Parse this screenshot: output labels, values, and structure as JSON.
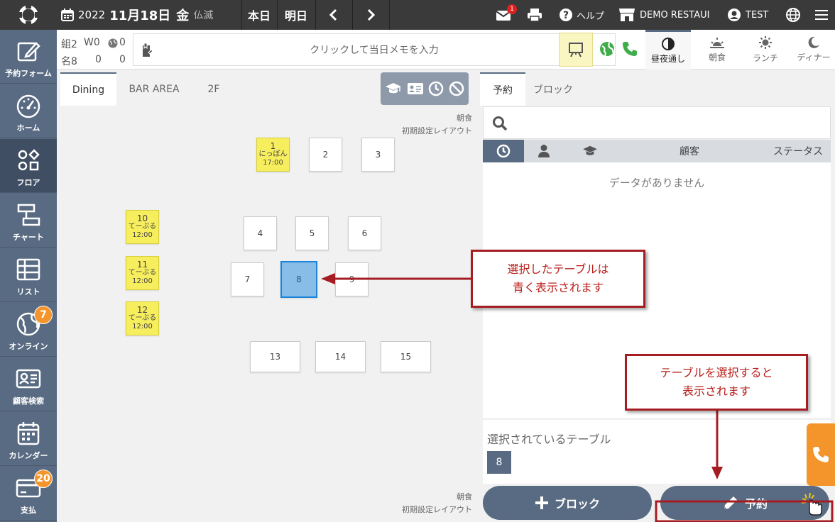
{
  "topbar": {
    "year": "2022",
    "date": "11月18日",
    "weekday": "金",
    "rokuyo": "仏滅",
    "today_label": "本日",
    "tomorrow_label": "明日",
    "mail_badge": "1",
    "help_label": "ヘルプ",
    "store_label": "DEMO RESTAUI",
    "user_label": "TEST"
  },
  "sidebar": {
    "items": [
      {
        "label": "予約フォーム",
        "icon": "edit-icon"
      },
      {
        "label": "ホーム",
        "icon": "dashboard-gauge-icon"
      },
      {
        "label": "フロア",
        "icon": "floor-shapes-icon"
      },
      {
        "label": "チャート",
        "icon": "chart-icon"
      },
      {
        "label": "リスト",
        "icon": "list-table-icon"
      },
      {
        "label": "オンライン",
        "icon": "globe-icon",
        "badge": "7"
      },
      {
        "label": "顧客検索",
        "icon": "customer-card-icon"
      },
      {
        "label": "カレンダー",
        "icon": "calendar-icon"
      },
      {
        "label": "支払",
        "icon": "payment-card-icon",
        "badge": "20"
      }
    ]
  },
  "stats": {
    "groups_label": "組",
    "groups_value": "2",
    "walkin_label": "W",
    "walkin_groups": "0",
    "web_groups": "0",
    "people_label": "名",
    "people_value": "8",
    "walkin_people": "0",
    "web_people": "0"
  },
  "memo": {
    "placeholder": "クリックして当日メモを入力"
  },
  "timeslots": [
    {
      "label": "昼夜通し",
      "icon": "half-circle-icon"
    },
    {
      "label": "朝食",
      "icon": "sunrise-icon"
    },
    {
      "label": "ランチ",
      "icon": "sun-icon"
    },
    {
      "label": "ディナー",
      "icon": "moon-icon"
    }
  ],
  "floor": {
    "tabs": [
      "Dining",
      "BAR AREA",
      "2F"
    ],
    "layout_note_meal": "朝食",
    "layout_note_layout": "初期設定レイアウト",
    "tables": [
      {
        "number": "1",
        "name": "にっぽん",
        "time": "17:00",
        "reserved": true
      },
      {
        "number": "2"
      },
      {
        "number": "3"
      },
      {
        "number": "10",
        "name": "てーぶる",
        "time": "12:00",
        "reserved": true
      },
      {
        "number": "4"
      },
      {
        "number": "5"
      },
      {
        "number": "6"
      },
      {
        "number": "11",
        "name": "てーぶる",
        "time": "12:00",
        "reserved": true
      },
      {
        "number": "7"
      },
      {
        "number": "8",
        "selected": true
      },
      {
        "number": "9"
      },
      {
        "number": "12",
        "name": "てーぶる",
        "time": "12:00",
        "reserved": true
      },
      {
        "number": "13"
      },
      {
        "number": "14"
      },
      {
        "number": "15"
      }
    ]
  },
  "right": {
    "tabs": [
      "予約",
      "ブロック"
    ],
    "columns": {
      "customer": "顧客",
      "status": "ステータス"
    },
    "empty_message": "データがありません",
    "selected_label": "選択されているテーブル",
    "selected_table": "8",
    "block_button": "ブロック",
    "reserve_button": "予約"
  },
  "callouts": {
    "table_line1": "選択したテーブルは",
    "table_line2": "青く表示されます",
    "button_line1": "テーブルを選択すると",
    "button_line2": "表示されます"
  },
  "colors": {
    "sidebar": "#596b82",
    "topbar": "#3a3a3a",
    "reserved": "#f7ee5e",
    "selected": "#88bde8",
    "accent_orange": "#f3952a",
    "annotation_red": "#a51d23"
  }
}
